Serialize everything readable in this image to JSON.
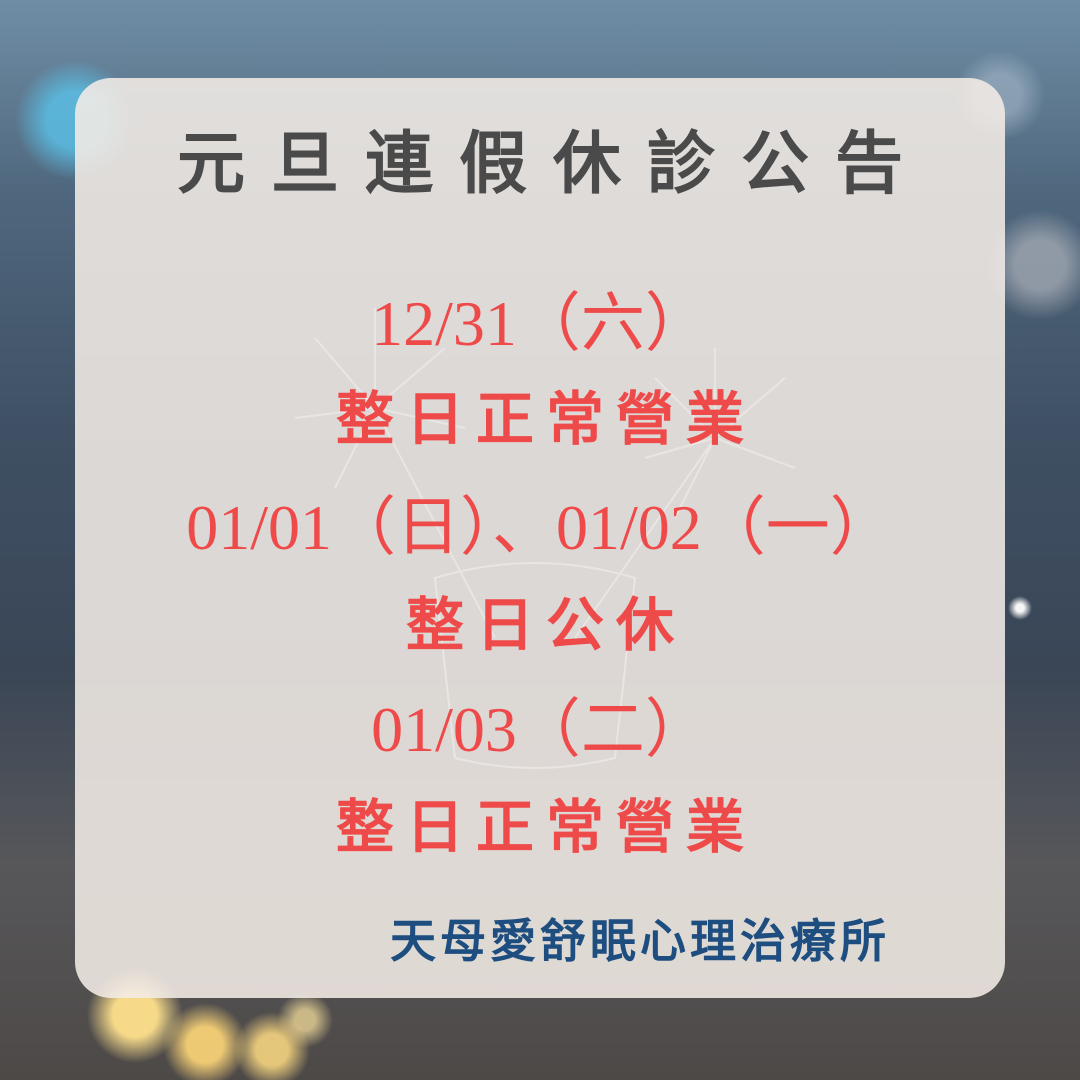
{
  "notice": {
    "title": "元旦連假休診公告",
    "blocks": [
      {
        "date": "12/31（六）",
        "status": "整日正常營業"
      },
      {
        "date": "01/01（日）、01/02（一）",
        "status": "整日公休"
      },
      {
        "date": "01/03（二）",
        "status": "整日正常營業"
      }
    ],
    "clinic_name": "天母愛舒眠心理治療所"
  },
  "colors": {
    "title": "#4a4a4a",
    "schedule_text": "#ee4a4a",
    "clinic_name": "#1e4d80",
    "card_background": "#f2ece6"
  }
}
